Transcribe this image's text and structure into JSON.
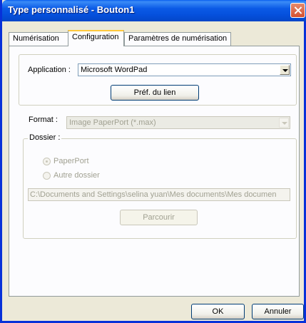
{
  "window": {
    "title": "Type personnalisé - Bouton1"
  },
  "tabs": [
    {
      "label": "Numérisation"
    },
    {
      "label": "Configuration"
    },
    {
      "label": "Paramètres de numérisation"
    }
  ],
  "application": {
    "label": "Application :",
    "selected": "Microsoft WordPad",
    "link_prefs_button": "Préf. du lien"
  },
  "format": {
    "label": "Format :",
    "selected": "Image PaperPort (*.max)"
  },
  "dossier": {
    "legend": "Dossier :",
    "options": [
      {
        "label": "PaperPort",
        "checked": true
      },
      {
        "label": "Autre dossier",
        "checked": false
      }
    ],
    "path": "C:\\Documents and Settings\\selina yuan\\Mes documents\\Mes documen",
    "browse_button": "Parcourir"
  },
  "footer": {
    "ok_button": "OK",
    "cancel_button": "Annuler"
  }
}
